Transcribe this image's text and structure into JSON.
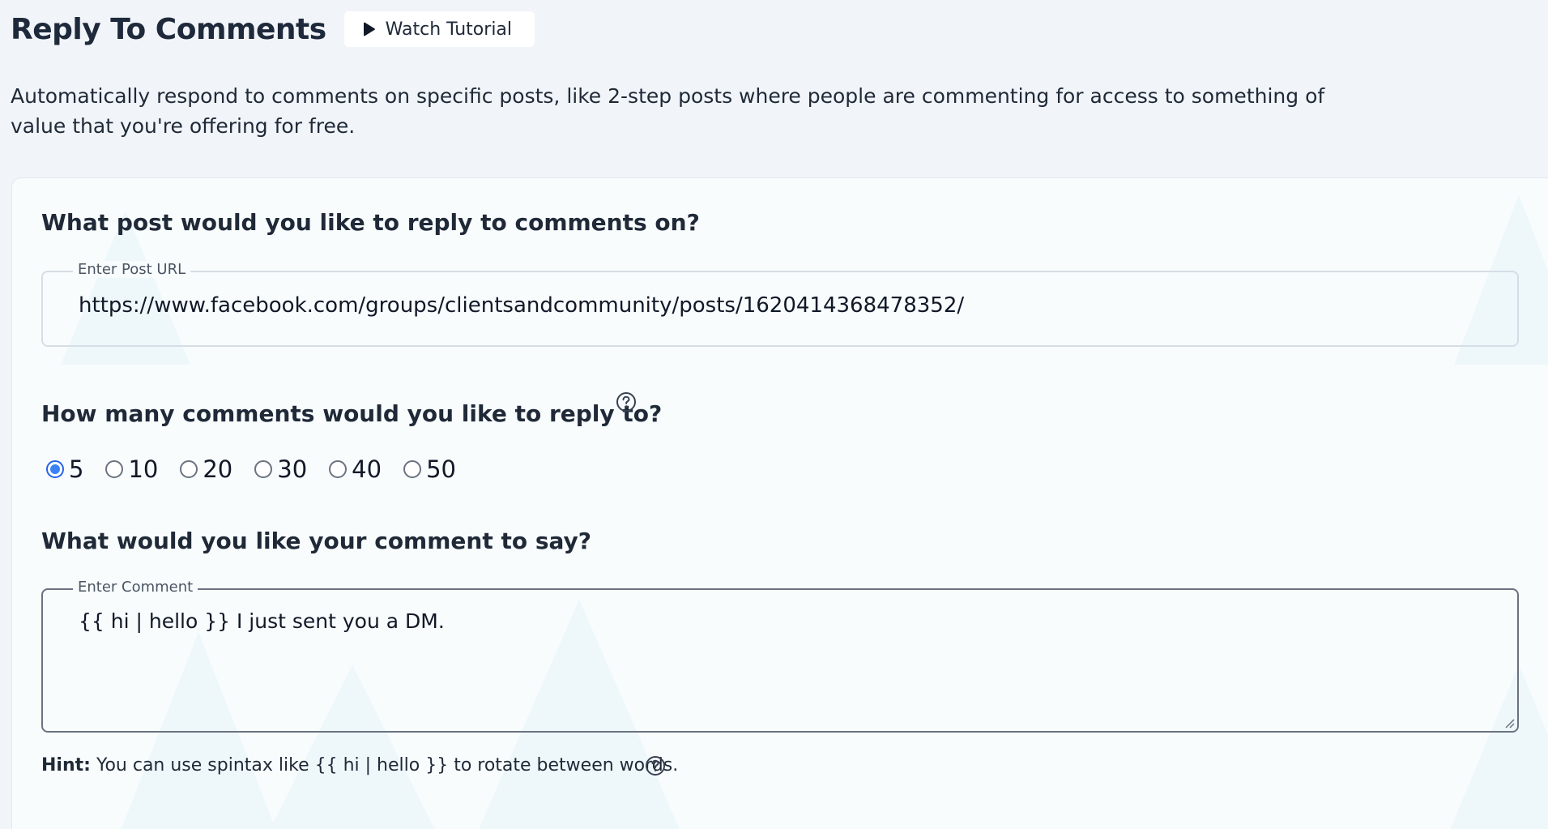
{
  "header": {
    "title": "Reply To Comments",
    "tutorial_button": "Watch Tutorial"
  },
  "description": "Automatically respond to comments on specific posts, like 2-step posts where people are commenting for access to something of value that you're offering for free.",
  "post_section": {
    "question": "What post would you like to reply to comments on?",
    "field_label": "Enter Post URL",
    "value": "https://www.facebook.com/groups/clientsandcommunity/posts/1620414368478352/"
  },
  "count_section": {
    "question": "How many comments would you like to reply to?",
    "options": [
      "5",
      "10",
      "20",
      "30",
      "40",
      "50"
    ],
    "selected": "5"
  },
  "comment_section": {
    "question": "What would you like your comment to say?",
    "field_label": "Enter Comment",
    "value": "{{ hi | hello }} I just sent you a DM."
  },
  "hint": {
    "prefix": "Hint:",
    "text": "You can use spintax like {{ hi | hello }} to rotate between words."
  },
  "colors": {
    "accent": "#3b82f6",
    "background": "#f1f5f9",
    "card": "#f8fcfd"
  },
  "icons": {
    "tutorial": "play-icon",
    "help": "question-circle-icon"
  }
}
